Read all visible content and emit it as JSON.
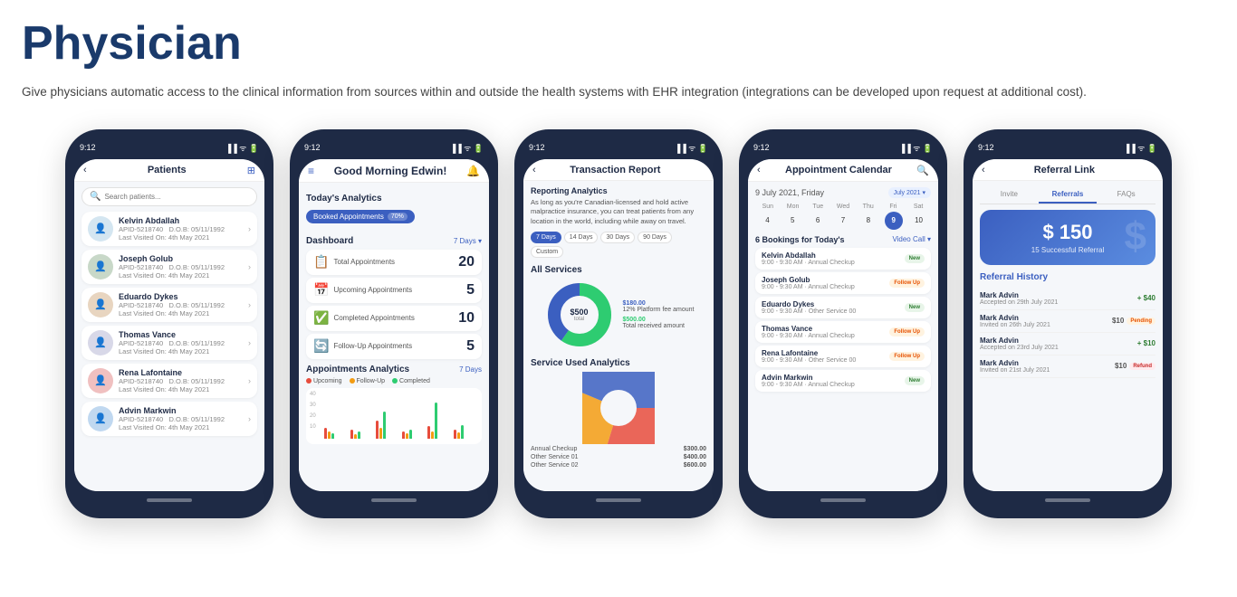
{
  "page": {
    "title": "Physician",
    "description": "Give physicians automatic access to the clinical information from sources within and outside the health systems with EHR integration (integrations can be developed upon request at additional cost)."
  },
  "phones": [
    {
      "id": "patients",
      "time": "9:12",
      "header_title": "Patients",
      "search_placeholder": "Search patients...",
      "patients": [
        {
          "name": "Kelvin Abdallah",
          "id": "APID-5218740",
          "dob": "D.O.B: 05/11/1992",
          "last": "Last Visited On: 4th May 2021"
        },
        {
          "name": "Joseph Golub",
          "id": "APID-5218740",
          "dob": "D.O.B: 05/11/1992",
          "last": "Last Visited On: 4th May 2021"
        },
        {
          "name": "Eduardo Dykes",
          "id": "APID-5218740",
          "dob": "D.O.B: 05/11/1992",
          "last": "Last Visited On: 4th May 2021"
        },
        {
          "name": "Thomas Vance",
          "id": "APID-5218740",
          "dob": "D.O.B: 05/11/1992",
          "last": "Last Visited On: 4th May 2021"
        },
        {
          "name": "Rena Lafontaine",
          "id": "APID-5218740",
          "dob": "D.O.B: 05/11/1992",
          "last": "Last Visited On: 4th May 2021"
        },
        {
          "name": "Advin Markwin",
          "id": "APID-5218740",
          "dob": "D.O.B: 05/11/1992",
          "last": "Last Visited On: 4th May 2021"
        }
      ]
    },
    {
      "id": "dashboard",
      "time": "9:12",
      "greeting": "Good Morning Edwin!",
      "analytics_title": "Today's Analytics",
      "booked_label": "Booked Appointments",
      "booked_pct": "70%",
      "dashboard_title": "Dashboard",
      "period": "7 Days",
      "stats": [
        {
          "icon": "📋",
          "label": "Total Appointments",
          "value": "20"
        },
        {
          "icon": "📅",
          "label": "Upcoming Appointments",
          "value": "5"
        },
        {
          "icon": "✅",
          "label": "Completed Appointments",
          "value": "10"
        },
        {
          "icon": "🔄",
          "label": "Follow-Up Appointments",
          "value": "5"
        }
      ],
      "appt_analytics_title": "Appointments Analytics",
      "appt_period": "7 Days",
      "legend": [
        "Upcoming",
        "Follow-Up",
        "Completed"
      ],
      "legend_colors": [
        "#e74c3c",
        "#f39c12",
        "#2ecc71"
      ]
    },
    {
      "id": "transaction",
      "time": "9:12",
      "header_title": "Transaction Report",
      "reporting_title": "Reporting Analytics",
      "reporting_desc": "As long as you're Canadian-licensed and hold active malpractice insurance, you can treat patients from any location in the world, including while away on travel.",
      "filters": [
        "7 Days",
        "14 Days",
        "30 Days",
        "90 Days",
        "Custom"
      ],
      "active_filter": "7 Days",
      "all_services_title": "All Services",
      "donut_top": "$180.00",
      "donut_top_label": "12% Platform fee amount",
      "donut_amount": "$500.00",
      "donut_label": "Total received amount",
      "service_analytics_title": "Service Used Analytics"
    },
    {
      "id": "calendar",
      "time": "9:12",
      "header_title": "Appointment Calendar",
      "cal_date": "9 July 2021, Friday",
      "cal_month": "July 2021",
      "days_header": [
        "Sun",
        "Mon",
        "Tue",
        "Wed",
        "Thu",
        "Fri",
        "Sat"
      ],
      "days": [
        "4",
        "5",
        "6",
        "7",
        "8",
        "9",
        "10"
      ],
      "today_day": "9",
      "bookings_title": "6 Bookings for Today's",
      "video_call": "Video Call",
      "bookings": [
        {
          "name": "Kelvin Abdallah",
          "time": "9:00 - 9:30 AM",
          "service": "Annual Checkup",
          "badge": "New"
        },
        {
          "name": "Joseph Golub",
          "time": "9:00 - 9:30 AM",
          "service": "Annual Checkup",
          "badge": "Follow Up"
        },
        {
          "name": "Eduardo Dykes",
          "time": "9:00 - 9:30 AM",
          "service": "Other Service 00",
          "badge": "New"
        },
        {
          "name": "Thomas Vance",
          "time": "9:00 - 9:30 AM",
          "service": "Annual Checkup",
          "badge": "Follow Up"
        },
        {
          "name": "Rena Lafontaine",
          "time": "9:00 - 9:30 AM",
          "service": "Other Service 00",
          "badge": "Follow Up"
        },
        {
          "name": "Advin Markwin",
          "time": "9:00 - 9:30 AM",
          "service": "Annual Checkup",
          "badge": "New"
        }
      ]
    },
    {
      "id": "referral",
      "time": "9:12",
      "header_title": "Referral Link",
      "tabs": [
        "Invite",
        "Referrals",
        "FAQs"
      ],
      "active_tab": "Referrals",
      "amount": "$ 150",
      "amount_sub": "15 Successful Referral",
      "history_title": "Referral History",
      "history": [
        {
          "name": "Mark Advin",
          "date": "Accepted on 29th July 2021",
          "amount": "+ $40",
          "type": "accepted"
        },
        {
          "name": "Mark Advin",
          "date": "Invited on 26th July 2021",
          "amount": "$10",
          "type": "pending"
        },
        {
          "name": "Mark Advin",
          "date": "Accepted on 23rd July 2021",
          "amount": "+ $10",
          "type": "accepted"
        },
        {
          "name": "Mark Advin",
          "date": "Invited on 21st July 2021",
          "amount": "$10",
          "type": "refund"
        }
      ]
    }
  ]
}
